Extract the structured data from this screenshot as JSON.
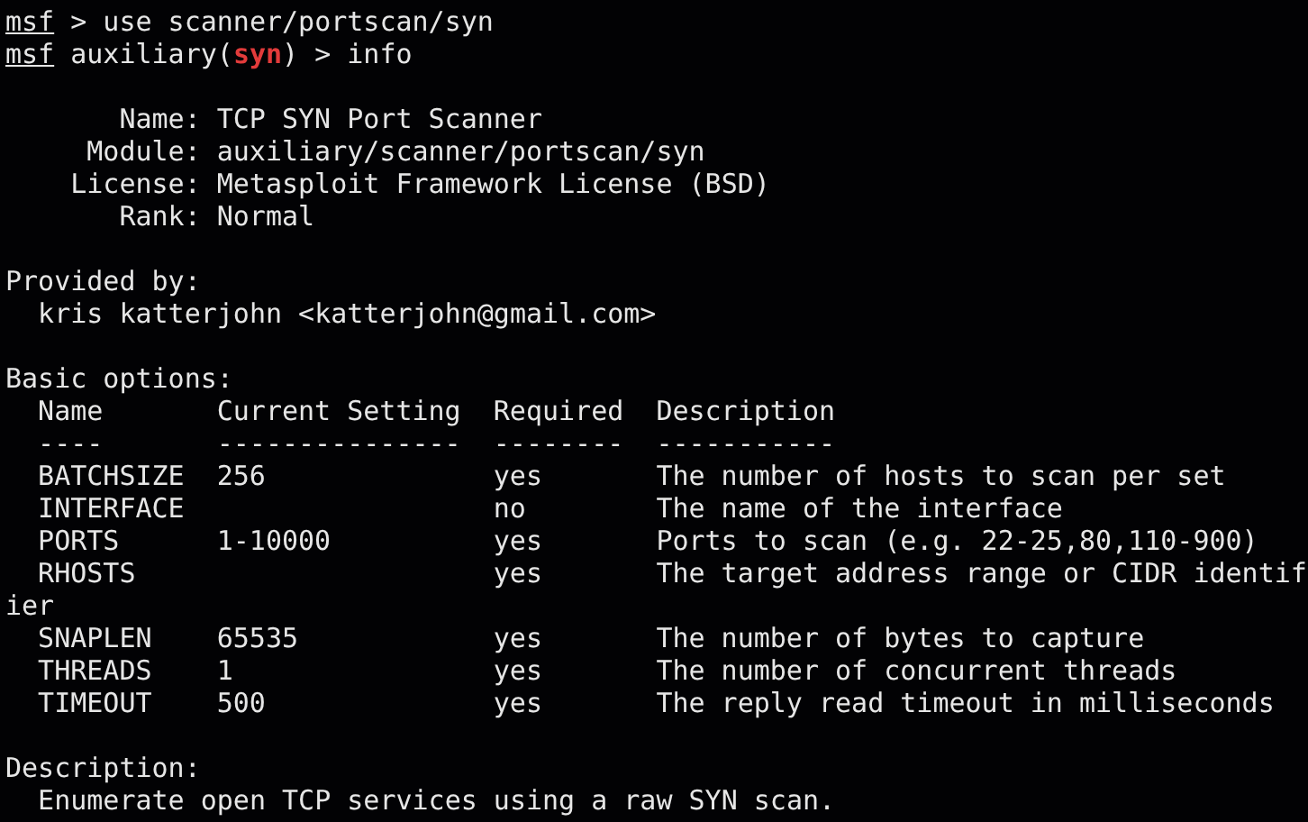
{
  "prompts": [
    {
      "segments": [
        {
          "kind": "prompt",
          "text": "msf"
        },
        {
          "kind": "text",
          "text": " > use scanner/portscan/syn"
        }
      ]
    },
    {
      "segments": [
        {
          "kind": "prompt",
          "text": "msf"
        },
        {
          "kind": "text",
          "text": " auxiliary("
        },
        {
          "kind": "module",
          "text": "syn"
        },
        {
          "kind": "text",
          "text": ") > info"
        }
      ]
    }
  ],
  "info": {
    "fields": [
      {
        "label": "Name:",
        "value": "TCP SYN Port Scanner"
      },
      {
        "label": "Module:",
        "value": "auxiliary/scanner/portscan/syn"
      },
      {
        "label": "License:",
        "value": "Metasploit Framework License (BSD)"
      },
      {
        "label": "Rank:",
        "value": "Normal"
      }
    ]
  },
  "provided_by": {
    "heading": "Provided by:",
    "authors": [
      "kris katterjohn <katterjohn@gmail.com>"
    ]
  },
  "options": {
    "heading": "Basic options:",
    "columns": [
      "Name",
      "Current Setting",
      "Required",
      "Description"
    ],
    "rules": [
      "----",
      "---------------",
      "--------",
      "-----------"
    ],
    "rows": [
      {
        "name": "BATCHSIZE",
        "setting": "256",
        "required": "yes",
        "description": "The number of hosts to scan per set"
      },
      {
        "name": "INTERFACE",
        "required": "no",
        "description": "The name of the interface"
      },
      {
        "name": "PORTS",
        "setting": "1-10000",
        "required": "yes",
        "description": "Ports to scan (e.g. 22-25,80,110-900)"
      },
      {
        "name": "RHOSTS",
        "required": "yes",
        "description": "The target address range or CIDR identif",
        "overflow": "ier"
      },
      {
        "name": "SNAPLEN",
        "setting": "65535",
        "required": "yes",
        "description": "The number of bytes to capture"
      },
      {
        "name": "THREADS",
        "setting": "1",
        "required": "yes",
        "description": "The number of concurrent threads"
      },
      {
        "name": "TIMEOUT",
        "setting": "500",
        "required": "yes",
        "description": "The reply read timeout in milliseconds"
      }
    ]
  },
  "description": {
    "heading": "Description:",
    "text": "Enumerate open TCP services using a raw SYN scan."
  }
}
